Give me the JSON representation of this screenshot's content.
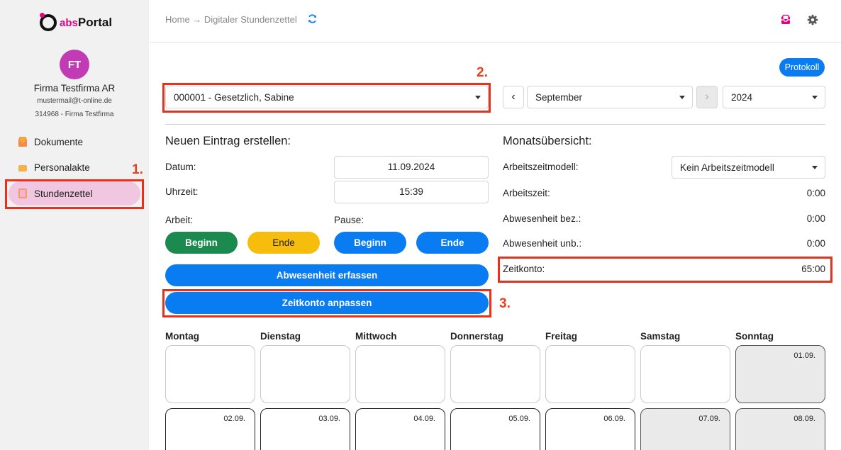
{
  "brand": {
    "abs": "abs",
    "portal": "Portal"
  },
  "user": {
    "initials": "FT",
    "company": "Firma Testfirma AR",
    "email": "mustermail@t-online.de",
    "id_line": "314968 - Firma Testfirma"
  },
  "sidebar": {
    "items": [
      {
        "label": "Dokumente",
        "icon": "person-icon"
      },
      {
        "label": "Personalakte",
        "icon": "briefcase-icon"
      },
      {
        "label": "Stundenzettel",
        "icon": "calendar-icon",
        "active": true
      }
    ]
  },
  "header": {
    "breadcrumb": "Home → Digitaler Stundenzettel"
  },
  "annotations": {
    "a1": "1.",
    "a2": "2.",
    "a3": "3."
  },
  "toolbar": {
    "protokoll": "Protokoll",
    "employee": "000001 - Gesetzlich, Sabine",
    "prev": "‹",
    "next": "›",
    "month": "September",
    "year": "2024"
  },
  "entry": {
    "title": "Neuen Eintrag erstellen:",
    "date_label": "Datum:",
    "date_value": "11.09.2024",
    "time_label": "Uhrzeit:",
    "time_value": "15:39",
    "work_label": "Arbeit:",
    "pause_label": "Pause:",
    "work_start": "Beginn",
    "work_end": "Ende",
    "pause_start": "Beginn",
    "pause_end": "Ende",
    "absence_button": "Abwesenheit erfassen",
    "adjust_button": "Zeitkonto anpassen"
  },
  "summary": {
    "title": "Monatsübersicht:",
    "model_label": "Arbeitszeitmodell:",
    "model_value": "Kein Arbeitszeitmodell",
    "worktime_label": "Arbeitszeit:",
    "worktime_value": "0:00",
    "paid_absence_label": "Abwesenheit bez.:",
    "paid_absence_value": "0:00",
    "unpaid_absence_label": "Abwesenheit unb.:",
    "unpaid_absence_value": "0:00",
    "account_label": "Zeitkonto:",
    "account_value": "65:00"
  },
  "calendar": {
    "days": [
      "Montag",
      "Dienstag",
      "Mittwoch",
      "Donnerstag",
      "Freitag",
      "Samstag",
      "Sonntag"
    ],
    "week1": [
      "",
      "",
      "",
      "",
      "",
      "",
      "01.09."
    ],
    "week2": [
      "02.09.",
      "03.09.",
      "04.09.",
      "05.09.",
      "06.09.",
      "07.09.",
      "08.09."
    ]
  },
  "colors": {
    "accent": "#0a7cf2",
    "green": "#1b8a4e",
    "yellow": "#f6bd0d",
    "brand_pink": "#e5007d",
    "avatar": "#c13bb4",
    "annotation_red": "#e8301a"
  }
}
